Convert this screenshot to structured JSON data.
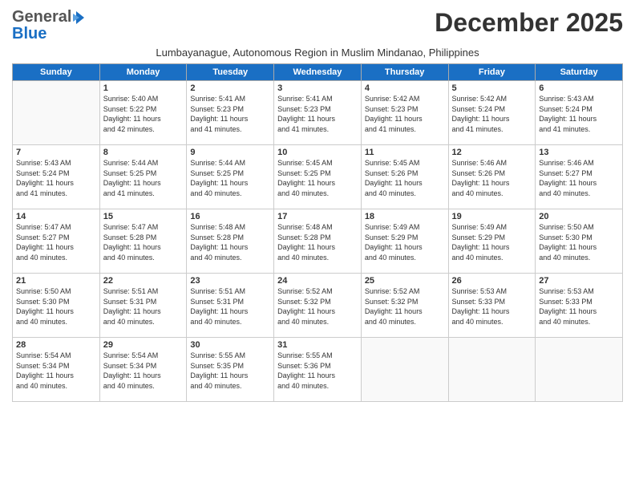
{
  "header": {
    "logo_general": "General",
    "logo_blue": "Blue",
    "month_year": "December 2025",
    "subtitle": "Lumbayanague, Autonomous Region in Muslim Mindanao, Philippines"
  },
  "days_of_week": [
    "Sunday",
    "Monday",
    "Tuesday",
    "Wednesday",
    "Thursday",
    "Friday",
    "Saturday"
  ],
  "weeks": [
    [
      {
        "day": "",
        "info": ""
      },
      {
        "day": "1",
        "info": "Sunrise: 5:40 AM\nSunset: 5:22 PM\nDaylight: 11 hours\nand 42 minutes."
      },
      {
        "day": "2",
        "info": "Sunrise: 5:41 AM\nSunset: 5:23 PM\nDaylight: 11 hours\nand 41 minutes."
      },
      {
        "day": "3",
        "info": "Sunrise: 5:41 AM\nSunset: 5:23 PM\nDaylight: 11 hours\nand 41 minutes."
      },
      {
        "day": "4",
        "info": "Sunrise: 5:42 AM\nSunset: 5:23 PM\nDaylight: 11 hours\nand 41 minutes."
      },
      {
        "day": "5",
        "info": "Sunrise: 5:42 AM\nSunset: 5:24 PM\nDaylight: 11 hours\nand 41 minutes."
      },
      {
        "day": "6",
        "info": "Sunrise: 5:43 AM\nSunset: 5:24 PM\nDaylight: 11 hours\nand 41 minutes."
      }
    ],
    [
      {
        "day": "7",
        "info": "Sunrise: 5:43 AM\nSunset: 5:24 PM\nDaylight: 11 hours\nand 41 minutes."
      },
      {
        "day": "8",
        "info": "Sunrise: 5:44 AM\nSunset: 5:25 PM\nDaylight: 11 hours\nand 41 minutes."
      },
      {
        "day": "9",
        "info": "Sunrise: 5:44 AM\nSunset: 5:25 PM\nDaylight: 11 hours\nand 40 minutes."
      },
      {
        "day": "10",
        "info": "Sunrise: 5:45 AM\nSunset: 5:25 PM\nDaylight: 11 hours\nand 40 minutes."
      },
      {
        "day": "11",
        "info": "Sunrise: 5:45 AM\nSunset: 5:26 PM\nDaylight: 11 hours\nand 40 minutes."
      },
      {
        "day": "12",
        "info": "Sunrise: 5:46 AM\nSunset: 5:26 PM\nDaylight: 11 hours\nand 40 minutes."
      },
      {
        "day": "13",
        "info": "Sunrise: 5:46 AM\nSunset: 5:27 PM\nDaylight: 11 hours\nand 40 minutes."
      }
    ],
    [
      {
        "day": "14",
        "info": "Sunrise: 5:47 AM\nSunset: 5:27 PM\nDaylight: 11 hours\nand 40 minutes."
      },
      {
        "day": "15",
        "info": "Sunrise: 5:47 AM\nSunset: 5:28 PM\nDaylight: 11 hours\nand 40 minutes."
      },
      {
        "day": "16",
        "info": "Sunrise: 5:48 AM\nSunset: 5:28 PM\nDaylight: 11 hours\nand 40 minutes."
      },
      {
        "day": "17",
        "info": "Sunrise: 5:48 AM\nSunset: 5:28 PM\nDaylight: 11 hours\nand 40 minutes."
      },
      {
        "day": "18",
        "info": "Sunrise: 5:49 AM\nSunset: 5:29 PM\nDaylight: 11 hours\nand 40 minutes."
      },
      {
        "day": "19",
        "info": "Sunrise: 5:49 AM\nSunset: 5:29 PM\nDaylight: 11 hours\nand 40 minutes."
      },
      {
        "day": "20",
        "info": "Sunrise: 5:50 AM\nSunset: 5:30 PM\nDaylight: 11 hours\nand 40 minutes."
      }
    ],
    [
      {
        "day": "21",
        "info": "Sunrise: 5:50 AM\nSunset: 5:30 PM\nDaylight: 11 hours\nand 40 minutes."
      },
      {
        "day": "22",
        "info": "Sunrise: 5:51 AM\nSunset: 5:31 PM\nDaylight: 11 hours\nand 40 minutes."
      },
      {
        "day": "23",
        "info": "Sunrise: 5:51 AM\nSunset: 5:31 PM\nDaylight: 11 hours\nand 40 minutes."
      },
      {
        "day": "24",
        "info": "Sunrise: 5:52 AM\nSunset: 5:32 PM\nDaylight: 11 hours\nand 40 minutes."
      },
      {
        "day": "25",
        "info": "Sunrise: 5:52 AM\nSunset: 5:32 PM\nDaylight: 11 hours\nand 40 minutes."
      },
      {
        "day": "26",
        "info": "Sunrise: 5:53 AM\nSunset: 5:33 PM\nDaylight: 11 hours\nand 40 minutes."
      },
      {
        "day": "27",
        "info": "Sunrise: 5:53 AM\nSunset: 5:33 PM\nDaylight: 11 hours\nand 40 minutes."
      }
    ],
    [
      {
        "day": "28",
        "info": "Sunrise: 5:54 AM\nSunset: 5:34 PM\nDaylight: 11 hours\nand 40 minutes."
      },
      {
        "day": "29",
        "info": "Sunrise: 5:54 AM\nSunset: 5:34 PM\nDaylight: 11 hours\nand 40 minutes."
      },
      {
        "day": "30",
        "info": "Sunrise: 5:55 AM\nSunset: 5:35 PM\nDaylight: 11 hours\nand 40 minutes."
      },
      {
        "day": "31",
        "info": "Sunrise: 5:55 AM\nSunset: 5:36 PM\nDaylight: 11 hours\nand 40 minutes."
      },
      {
        "day": "",
        "info": ""
      },
      {
        "day": "",
        "info": ""
      },
      {
        "day": "",
        "info": ""
      }
    ]
  ]
}
